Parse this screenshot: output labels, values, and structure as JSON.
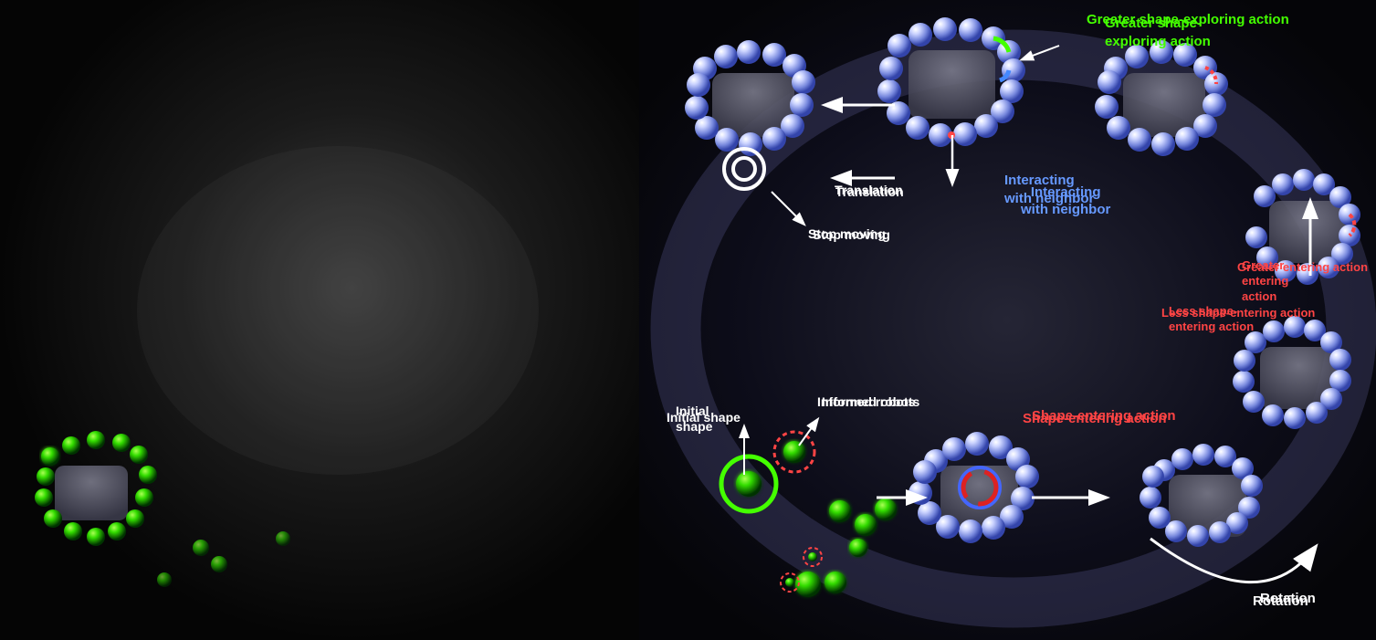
{
  "left_panel": {
    "description": "Dark simulation showing initial swarm state with green spheres and gray block robots"
  },
  "right_panel": {
    "description": "Diagram showing swarm behaviors in an oval formation",
    "labels": {
      "greater_shape_exploring": "Greater shape-exploring action",
      "interacting_with_neighbor": "Interacting with neighbor",
      "stop_moving": "Stop moving",
      "translation": "Translation",
      "initial_shape": "Initial shape",
      "informed_robots": "Informed robots",
      "shape_entering_action": "Shape-entering action",
      "less_shape_entering": "Less shape-entering action",
      "greater_entering": "Greater entering action",
      "rotation": "Rotation"
    }
  }
}
